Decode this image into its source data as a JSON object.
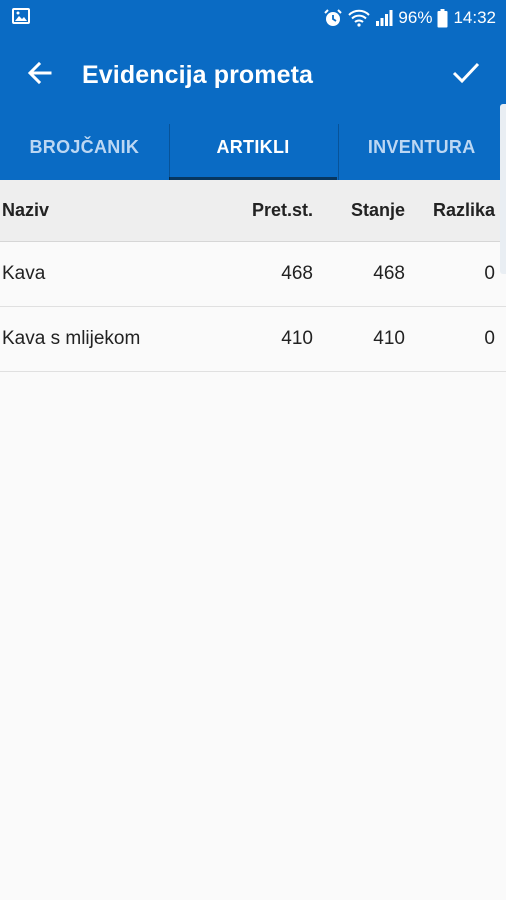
{
  "status_bar": {
    "battery_percent": "96%",
    "time": "14:32",
    "icons": [
      "image-icon",
      "alarm-icon",
      "wifi-icon",
      "signal-icon",
      "battery-icon"
    ]
  },
  "app_bar": {
    "title": "Evidencija prometa",
    "back_icon": "arrow-back-icon",
    "confirm_icon": "check-icon"
  },
  "tabs": [
    {
      "label": "BROJČANIK",
      "active": false
    },
    {
      "label": "ARTIKLI",
      "active": true
    },
    {
      "label": "INVENTURA",
      "active": false
    }
  ],
  "table": {
    "headers": {
      "naziv": "Naziv",
      "pret": "Pret.st.",
      "stanje": "Stanje",
      "razlika": "Razlika"
    },
    "rows": [
      {
        "naziv": "Kava",
        "pret": "468",
        "stanje": "468",
        "razlika": "0"
      },
      {
        "naziv": "Kava s mlijekom",
        "pret": "410",
        "stanje": "410",
        "razlika": "0"
      }
    ]
  },
  "colors": {
    "primary": "#0a6bc4",
    "tab_indicator": "#07365f",
    "background": "#fafafa",
    "header_bg": "#eeeeee"
  }
}
